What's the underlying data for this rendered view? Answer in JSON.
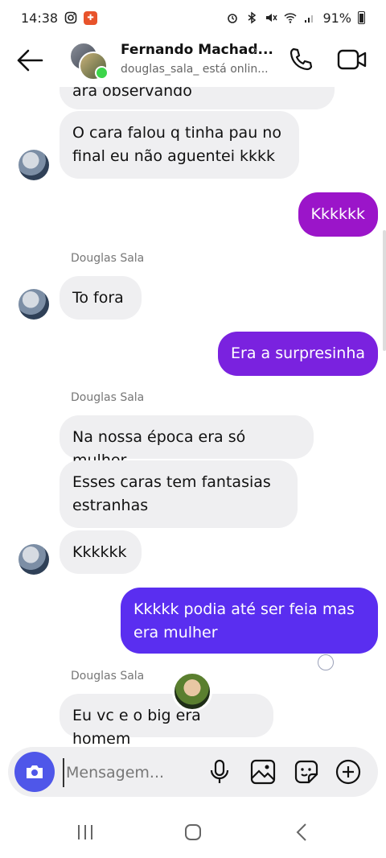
{
  "status_bar": {
    "time": "14:38",
    "battery": "91%"
  },
  "header": {
    "name": "Fernando Machad...",
    "status": "douglas_sala_ está onlin...",
    "chevron": "›"
  },
  "messages": [
    {
      "side": "in",
      "text": "ara observando",
      "avatar": false
    },
    {
      "side": "in",
      "text": "O cara falou q tinha pau no\nfinal eu não aguentei kkkk",
      "avatar": true
    },
    {
      "side": "out",
      "text": "Kkkkkk"
    },
    {
      "sender": "Douglas Sala"
    },
    {
      "side": "in",
      "text": "To fora",
      "avatar": true
    },
    {
      "side": "out",
      "text": "Era a surpresinha"
    },
    {
      "sender": "Douglas Sala"
    },
    {
      "side": "in",
      "text": "Na nossa época era só mulher",
      "avatar": false
    },
    {
      "side": "in",
      "text": "Esses caras tem fantasias\nestranhas",
      "avatar": false
    },
    {
      "side": "in",
      "text": "Kkkkkk",
      "avatar": true
    },
    {
      "side": "out",
      "text": "Kkkkk podia até ser feia mas\nera mulher"
    },
    {
      "sender": "Douglas Sala"
    },
    {
      "side": "in",
      "text": "Eu vc e o big era homem",
      "avatar": false
    }
  ],
  "composer": {
    "placeholder": "Mensagem..."
  },
  "colors": {
    "accent": "#4f57e9",
    "bubble_in": "#efeff1",
    "bubble_out_1": "#9b15c9",
    "bubble_out_2": "#7a22df",
    "bubble_out_3": "#5a2ef0",
    "online": "#3cd54a"
  },
  "icons": {
    "back": "arrow-left-icon",
    "call": "phone-icon",
    "video": "video-camera-icon",
    "camera": "camera-icon",
    "mic": "microphone-icon",
    "gallery": "image-icon",
    "sticker": "sticker-icon",
    "add": "plus-circle-icon"
  }
}
